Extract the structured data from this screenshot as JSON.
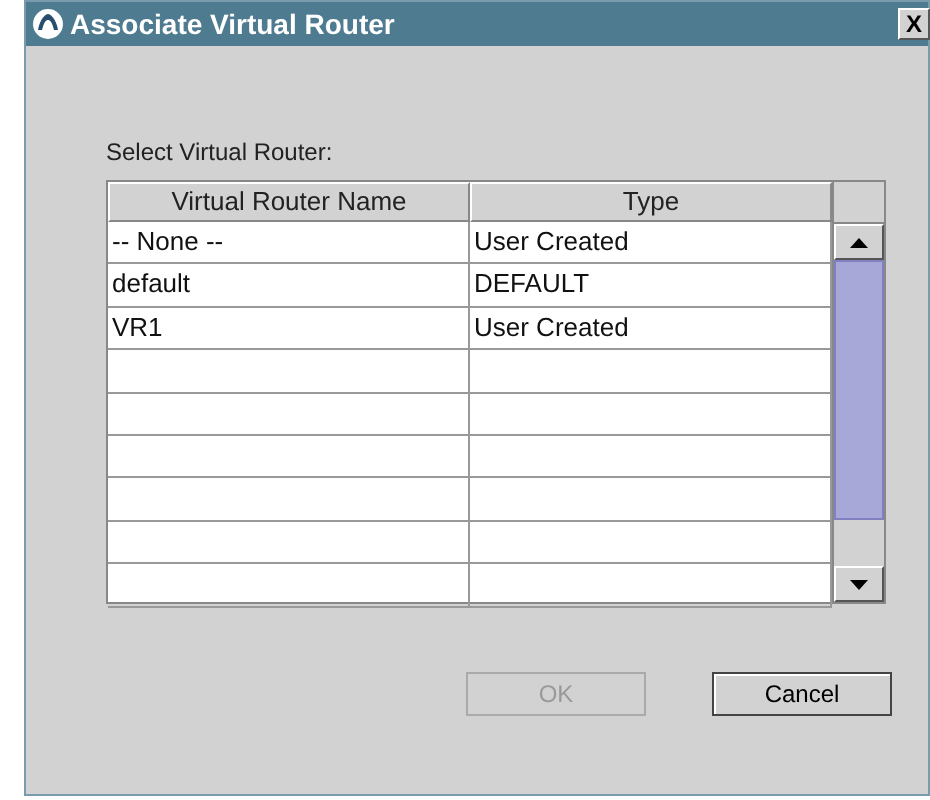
{
  "window": {
    "title": "Associate Virtual Router",
    "close": "X"
  },
  "prompt": "Select Virtual Router:",
  "table": {
    "columns": [
      "Virtual Router Name",
      "Type"
    ],
    "rows": [
      {
        "name": "-- None --",
        "type": "User Created"
      },
      {
        "name": "default",
        "type": "DEFAULT"
      },
      {
        "name": "VR1",
        "type": "User Created"
      }
    ]
  },
  "buttons": [
    {
      "label": "OK",
      "disabled": true
    },
    {
      "label": "Cancel",
      "disabled": false
    }
  ]
}
